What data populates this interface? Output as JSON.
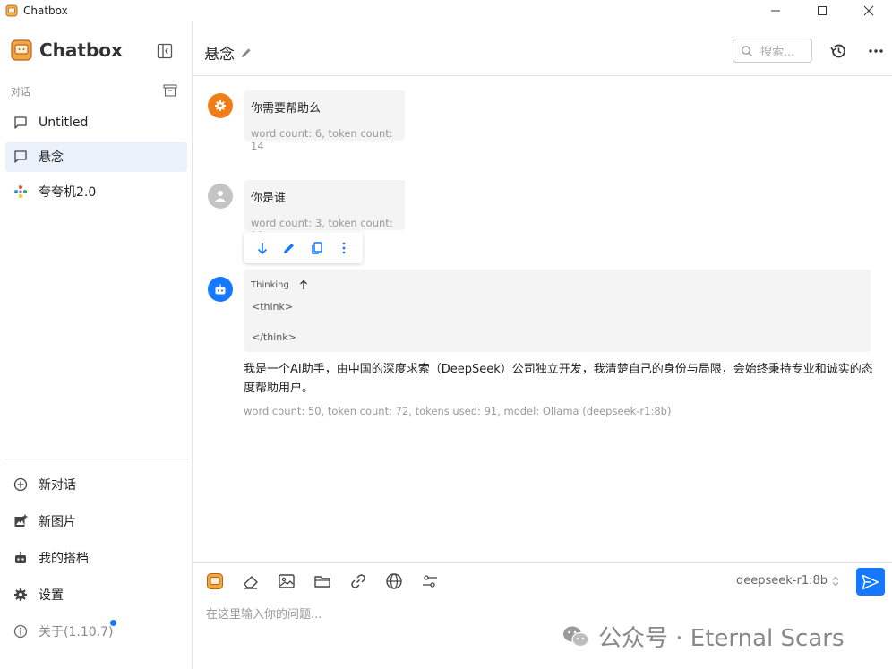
{
  "window": {
    "title": "Chatbox"
  },
  "sidebar": {
    "brand": "Chatbox",
    "section_label": "对话",
    "conversations": [
      {
        "label": "Untitled"
      },
      {
        "label": "悬念",
        "active": true
      },
      {
        "label": "夸夸机2.0"
      }
    ],
    "menu": [
      {
        "label": "新对话"
      },
      {
        "label": "新图片"
      },
      {
        "label": "我的搭档"
      },
      {
        "label": "设置"
      },
      {
        "label": "关于(1.10.7)"
      }
    ]
  },
  "header": {
    "title": "悬念",
    "search_placeholder": "搜索..."
  },
  "messages": {
    "system": {
      "text": "你需要帮助么",
      "meta": "word count: 6, token count: 14"
    },
    "user": {
      "text": "你是谁",
      "meta": "word count: 3, token count: 11"
    },
    "assistant": {
      "thinking_label": "Thinking",
      "think_open": "<think>",
      "think_close": "</think>",
      "text": "我是一个AI助手，由中国的深度求索（DeepSeek）公司独立开发，我清楚自己的身份与局限，会始终秉持专业和诚实的态度帮助用户。",
      "meta": "word count: 50, token count: 72, tokens used: 91, model: Ollama (deepseek-r1:8b)"
    }
  },
  "input": {
    "model": "deepseek-r1:8b",
    "placeholder": "在这里输入你的问题..."
  },
  "watermark": {
    "text": "公众号 · Eternal Scars"
  },
  "colors": {
    "accent": "#1677ff",
    "system_avatar": "#f07c1a",
    "user_avatar": "#c4c4c4",
    "bot_avatar": "#1677ff"
  }
}
